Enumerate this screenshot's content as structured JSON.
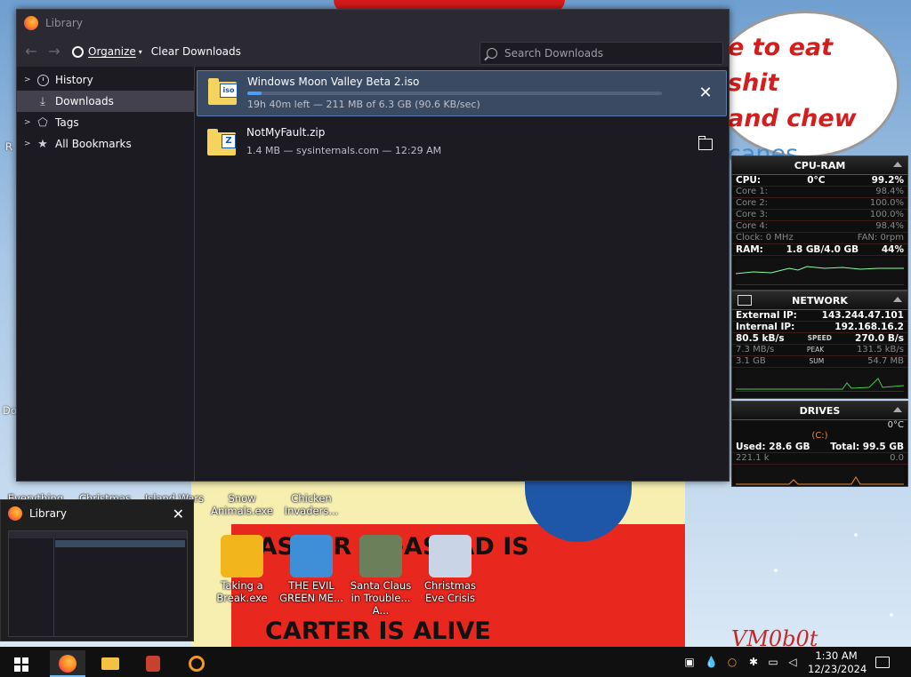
{
  "window": {
    "title": "Library",
    "toolbar": {
      "organize": "Organize",
      "clear": "Clear Downloads"
    },
    "search_placeholder": "Search Downloads"
  },
  "sidebar": [
    {
      "label": "History",
      "icon": "clock-icon"
    },
    {
      "label": "Downloads",
      "icon": "download-icon",
      "selected": true
    },
    {
      "label": "Tags",
      "icon": "tag-icon"
    },
    {
      "label": "All Bookmarks",
      "icon": "star-icon"
    }
  ],
  "downloads": [
    {
      "name": "Windows Moon Valley Beta 2.iso",
      "badge": "iso",
      "status": "19h 40m left — 211 MB of 6.3 GB (90.6 KB/sec)",
      "progress": 0.034
    },
    {
      "name": "NotMyFault.zip",
      "badge": "Z",
      "status": "1.4 MB — sysinternals.com — 12:29 AM"
    }
  ],
  "preview": {
    "title": "Library"
  },
  "desktop": {
    "bubble": {
      "line1": "e to eat shit",
      "line2": "and chew",
      "line3": "canes"
    },
    "poster": {
      "line1": "BASHAR AL-ASSAD IS",
      "line2": "CARTER IS ALIVE"
    },
    "signature": "VM0b0t",
    "icons": [
      {
        "label": "Everything"
      },
      {
        "label": "Christmas"
      },
      {
        "label": "Island Wars 2"
      },
      {
        "label": "Snow Animals.exe"
      },
      {
        "label": "Chicken Invaders..."
      },
      {
        "label": "Taking a Break.exe"
      },
      {
        "label": "THE EVIL GREEN ME..."
      },
      {
        "label": "Santa Claus in Trouble... A..."
      },
      {
        "label": "Christmas Eve Crisis"
      }
    ],
    "left_cut": [
      "R",
      "Do"
    ]
  },
  "gadgets": {
    "cpu": {
      "title": "CPU-RAM",
      "cpu_label": "CPU:",
      "temp": "0°C",
      "cpu_value": "99.2%",
      "cores": [
        {
          "label": "Core 1:",
          "value": "98.4%"
        },
        {
          "label": "Core 2:",
          "value": "100.0%"
        },
        {
          "label": "Core 3:",
          "value": "100.0%"
        },
        {
          "label": "Core 4:",
          "value": "98.4%"
        }
      ],
      "clock_label": "Clock: 0 MHz",
      "fan_label": "FAN: 0rpm",
      "ram_label": "RAM:",
      "ram_value": "1.8 GB/4.0 GB",
      "ram_pct": "44%"
    },
    "network": {
      "title": "NETWORK",
      "ext_label": "External IP:",
      "ext_value": "143.244.47.101",
      "int_label": "Internal IP:",
      "int_value": "192.168.16.2",
      "rows": [
        {
          "left": "80.5 kB/s",
          "mid": "SPEED",
          "right": "270.0 B/s"
        },
        {
          "left": "7.3 MB/s",
          "mid": "PEAK",
          "right": "131.5 kB/s"
        },
        {
          "left": "3.1 GB",
          "mid": "SUM",
          "right": "54.7 MB"
        }
      ]
    },
    "drives": {
      "title": "DRIVES",
      "temp": "0°C",
      "drive_letter": "(C:)",
      "used": "Used: 28.6 GB",
      "total": "Total: 99.5 GB",
      "read": "221.1 k",
      "write": "0.0"
    }
  },
  "taskbar": {
    "time": "1:30 AM",
    "date": "12/23/2024"
  }
}
